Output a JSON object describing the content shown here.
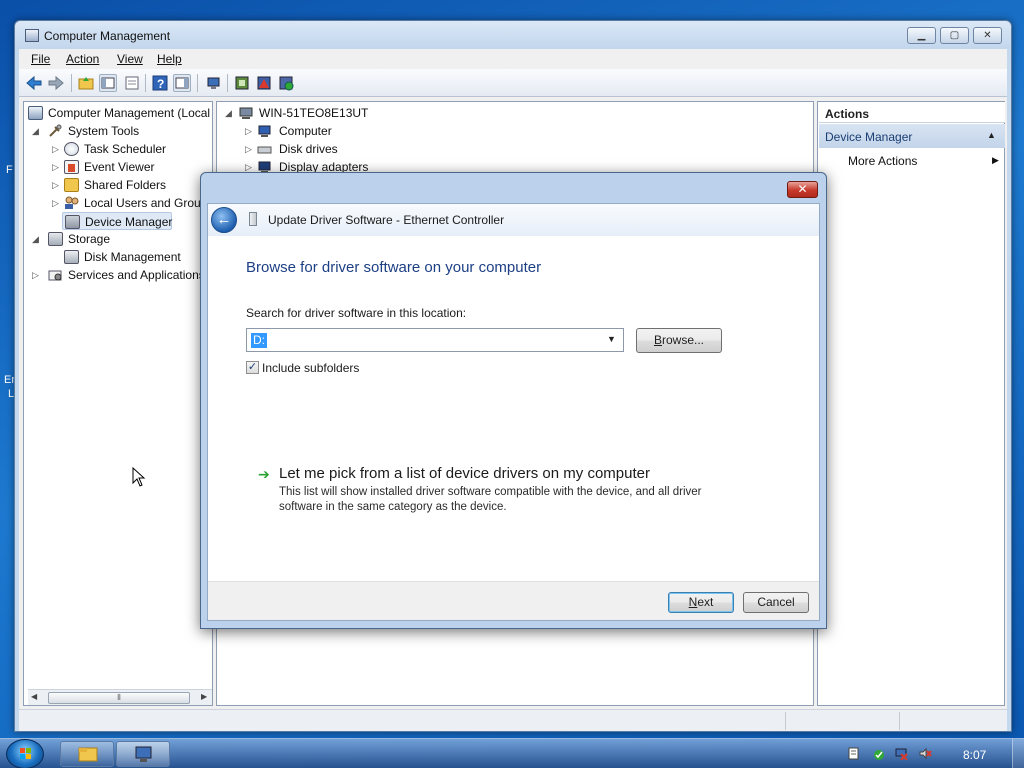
{
  "desktop": {
    "edge_text_1": "F",
    "edge_text_2": "Er",
    "edge_text_3": "L"
  },
  "window": {
    "title": "Computer Management",
    "minimize": "▁",
    "maximize": "▢",
    "close": "✕"
  },
  "menu": {
    "file": "File",
    "action": "Action",
    "view": "View",
    "help": "Help"
  },
  "toolbar": {
    "icons": [
      "back-icon",
      "forward-icon",
      "up-folder-icon",
      "show-hide-tree-icon",
      "properties-icon",
      "help-icon",
      "show-hide-action-icon",
      "scan-hardware-icon",
      "update-driver-icon",
      "uninstall-icon",
      "disable-device-icon"
    ]
  },
  "left_tree": {
    "root": "Computer Management (Local",
    "system_tools": "System Tools",
    "task_scheduler": "Task Scheduler",
    "event_viewer": "Event Viewer",
    "shared_folders": "Shared Folders",
    "local_users": "Local Users and Group",
    "device_manager": "Device Manager",
    "storage": "Storage",
    "disk_management": "Disk Management",
    "services": "Services and Applications"
  },
  "device_tree": {
    "host": "WIN-51TEO8E13UT",
    "items": [
      "Computer",
      "Disk drives",
      "Display adapters"
    ]
  },
  "actions_pane": {
    "heading": "Actions",
    "section": "Device Manager",
    "more": "More Actions"
  },
  "dialog": {
    "close": "✕",
    "title": "Update Driver Software - Ethernet Controller",
    "heading": "Browse for driver software on your computer",
    "search_label": "Search for driver software in this location:",
    "path_value": "D:",
    "browse_prefix": "B",
    "browse_rest": "rowse...",
    "include_subfolders": "Include subfolders",
    "include_subfolders_checked": true,
    "pick_link": "Let me pick from a list of device drivers on my computer",
    "pick_desc": "This list will show installed driver software compatible with the device, and all driver software in the same category as the device.",
    "next_prefix": "N",
    "next_rest": "ext",
    "cancel": "Cancel"
  },
  "taskbar": {
    "clock": "8:07",
    "apps": [
      "explorer-icon",
      "computer-management-icon"
    ],
    "tray": [
      "action-center-icon",
      "security-check-icon",
      "network-error-icon",
      "volume-muted-icon"
    ]
  },
  "colors": {
    "desktop": "#1d79cf",
    "selection": "#3399ff",
    "heading_blue": "#1d3f84",
    "link_arrow_green": "#2aa132"
  }
}
